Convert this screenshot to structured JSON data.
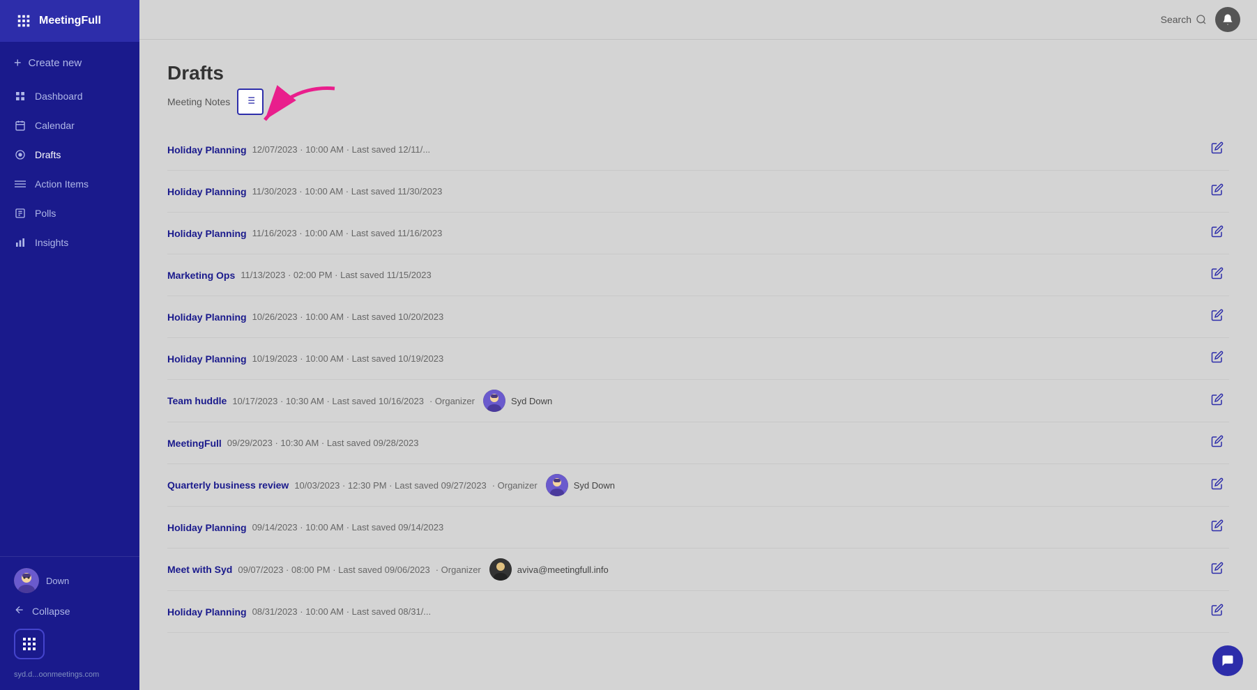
{
  "app": {
    "name": "MeetingFull"
  },
  "sidebar": {
    "logo_label": "MeetingFull",
    "create_new_label": "Create new",
    "items": [
      {
        "id": "dashboard",
        "label": "Dashboard",
        "icon": "grid"
      },
      {
        "id": "calendar",
        "label": "Calendar",
        "icon": "calendar"
      },
      {
        "id": "drafts",
        "label": "Drafts",
        "icon": "circle",
        "active": true
      },
      {
        "id": "action-items",
        "label": "Action Items",
        "icon": "lines"
      },
      {
        "id": "polls",
        "label": "Polls",
        "icon": "clipboard"
      },
      {
        "id": "insights",
        "label": "Insights",
        "icon": "bar-chart"
      }
    ],
    "collapse_label": "Collapse",
    "user": {
      "name": "Down",
      "email": "syd.d...oonmeetings.com"
    }
  },
  "header": {
    "search_placeholder": "Search",
    "search_label": "Search"
  },
  "main": {
    "page_title": "Drafts",
    "section_label": "Meeting Notes",
    "filter_tooltip": "Filter"
  },
  "drafts": [
    {
      "id": 1,
      "name": "Holiday Planning",
      "date": "12/07/2023",
      "time": "10:00 AM",
      "last_saved": "Last saved 12/11/...",
      "organizer": null,
      "organizer_name": null
    },
    {
      "id": 2,
      "name": "Holiday Planning",
      "date": "11/30/2023",
      "time": "10:00 AM",
      "last_saved": "Last saved 11/30/2023",
      "organizer": null,
      "organizer_name": null
    },
    {
      "id": 3,
      "name": "Holiday Planning",
      "date": "11/16/2023",
      "time": "10:00 AM",
      "last_saved": "Last saved 11/16/2023",
      "organizer": null,
      "organizer_name": null
    },
    {
      "id": 4,
      "name": "Marketing Ops",
      "date": "11/13/2023",
      "time": "02:00 PM",
      "last_saved": "Last saved 11/15/2023",
      "organizer": null,
      "organizer_name": null
    },
    {
      "id": 5,
      "name": "Holiday Planning",
      "date": "10/26/2023",
      "time": "10:00 AM",
      "last_saved": "Last saved 10/20/2023",
      "organizer": null,
      "organizer_name": null
    },
    {
      "id": 6,
      "name": "Holiday Planning",
      "date": "10/19/2023",
      "time": "10:00 AM",
      "last_saved": "Last saved 10/19/2023",
      "organizer": null,
      "organizer_name": null
    },
    {
      "id": 7,
      "name": "Team huddle",
      "date": "10/17/2023",
      "time": "10:30 AM",
      "last_saved": "Last saved 10/16/2023",
      "organizer": "Organizer",
      "organizer_name": "Syd Down",
      "organizer_type": "syd"
    },
    {
      "id": 8,
      "name": "MeetingFull",
      "date": "09/29/2023",
      "time": "10:30 AM",
      "last_saved": "Last saved 09/28/2023",
      "organizer": null,
      "organizer_name": null
    },
    {
      "id": 9,
      "name": "Quarterly business review",
      "date": "10/03/2023",
      "time": "12:30 PM",
      "last_saved": "Last saved 09/27/2023",
      "organizer": "Organizer",
      "organizer_name": "Syd Down",
      "organizer_type": "syd"
    },
    {
      "id": 10,
      "name": "Holiday Planning",
      "date": "09/14/2023",
      "time": "10:00 AM",
      "last_saved": "Last saved 09/14/2023",
      "organizer": null,
      "organizer_name": null
    },
    {
      "id": 11,
      "name": "Meet with Syd",
      "date": "09/07/2023",
      "time": "08:00 PM",
      "last_saved": "Last saved 09/06/2023",
      "organizer": "Organizer",
      "organizer_name": "aviva@meetingfull.info",
      "organizer_type": "aviva"
    },
    {
      "id": 12,
      "name": "Holiday Planning",
      "date": "08/31/2023",
      "time": "10:00 AM",
      "last_saved": "Last saved 08/31/...",
      "organizer": null,
      "organizer_name": null
    }
  ]
}
